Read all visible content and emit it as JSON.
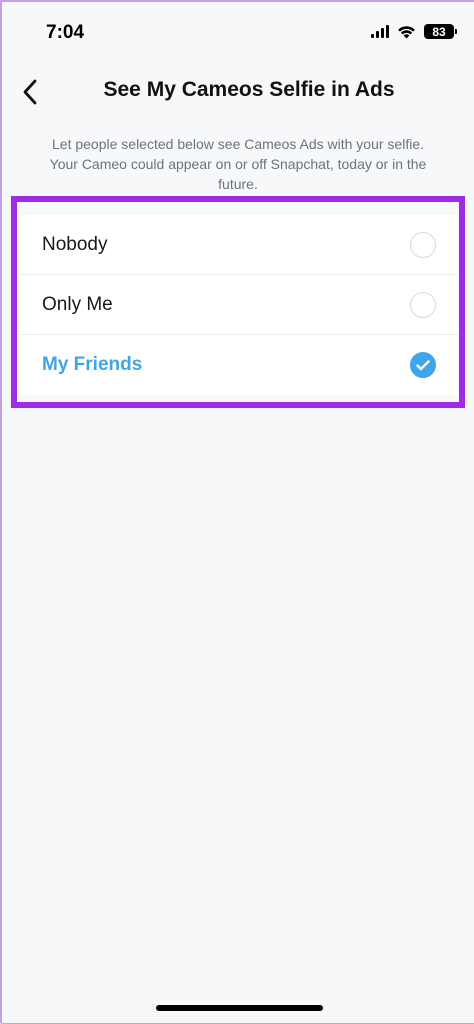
{
  "status_bar": {
    "time": "7:04",
    "battery": "83"
  },
  "header": {
    "back_icon": "chevron-left-icon",
    "title": "See My Cameos Selfie in Ads"
  },
  "description": "Let people selected below see Cameos Ads with your selfie. Your Cameo could appear on or off Snapchat, today or in the future.",
  "options": [
    {
      "label": "Nobody",
      "selected": false
    },
    {
      "label": "Only Me",
      "selected": false
    },
    {
      "label": "My Friends",
      "selected": true
    }
  ],
  "colors": {
    "accent": "#3FA4E8",
    "highlight": "#A12BE0",
    "background": "#F7F8F9"
  }
}
